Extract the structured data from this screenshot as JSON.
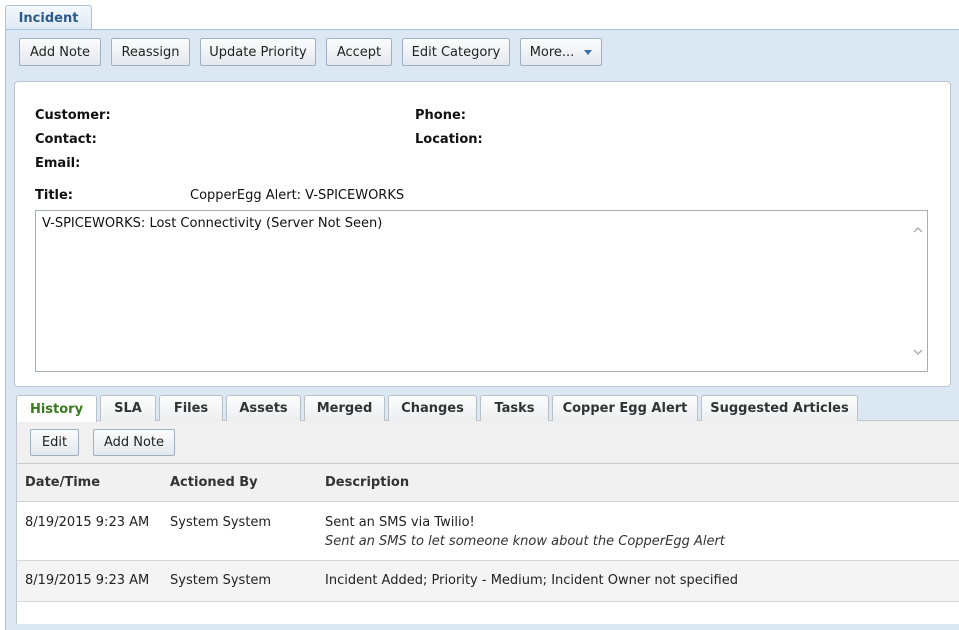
{
  "page_tab": "Incident",
  "toolbar": {
    "add_note": "Add Note",
    "reassign": "Reassign",
    "update_priority": "Update Priority",
    "accept": "Accept",
    "edit_category": "Edit Category",
    "more": "More..."
  },
  "details": {
    "customer_label": "Customer:",
    "contact_label": "Contact:",
    "email_label": "Email:",
    "phone_label": "Phone:",
    "location_label": "Location:",
    "title_label": "Title:",
    "title_value": "CopperEgg Alert: V-SPICEWORKS",
    "description": "V-SPICEWORKS: Lost Connectivity (Server Not Seen)"
  },
  "tabs": [
    "History",
    "SLA",
    "Files",
    "Assets",
    "Merged",
    "Changes",
    "Tasks",
    "Copper Egg Alert",
    "Suggested Articles"
  ],
  "history_toolbar": {
    "edit": "Edit",
    "add_note": "Add Note"
  },
  "history_table": {
    "columns": [
      "Date/Time",
      "Actioned By",
      "Description"
    ],
    "rows": [
      {
        "datetime": "8/19/2015 9:23 AM",
        "actioned_by": "System System",
        "description": "Sent an SMS via Twilio!",
        "detail": "Sent an SMS to let someone know about the CopperEgg Alert"
      },
      {
        "datetime": "8/19/2015 9:23 AM",
        "actioned_by": "System System",
        "description": "Incident Added; Priority - Medium; Incident Owner not specified",
        "detail": ""
      }
    ]
  },
  "colors": {
    "accent_blue": "#2a5b8c",
    "active_tab_green": "#3a7a1e",
    "toolbar_bg": "#dbe7f3"
  }
}
